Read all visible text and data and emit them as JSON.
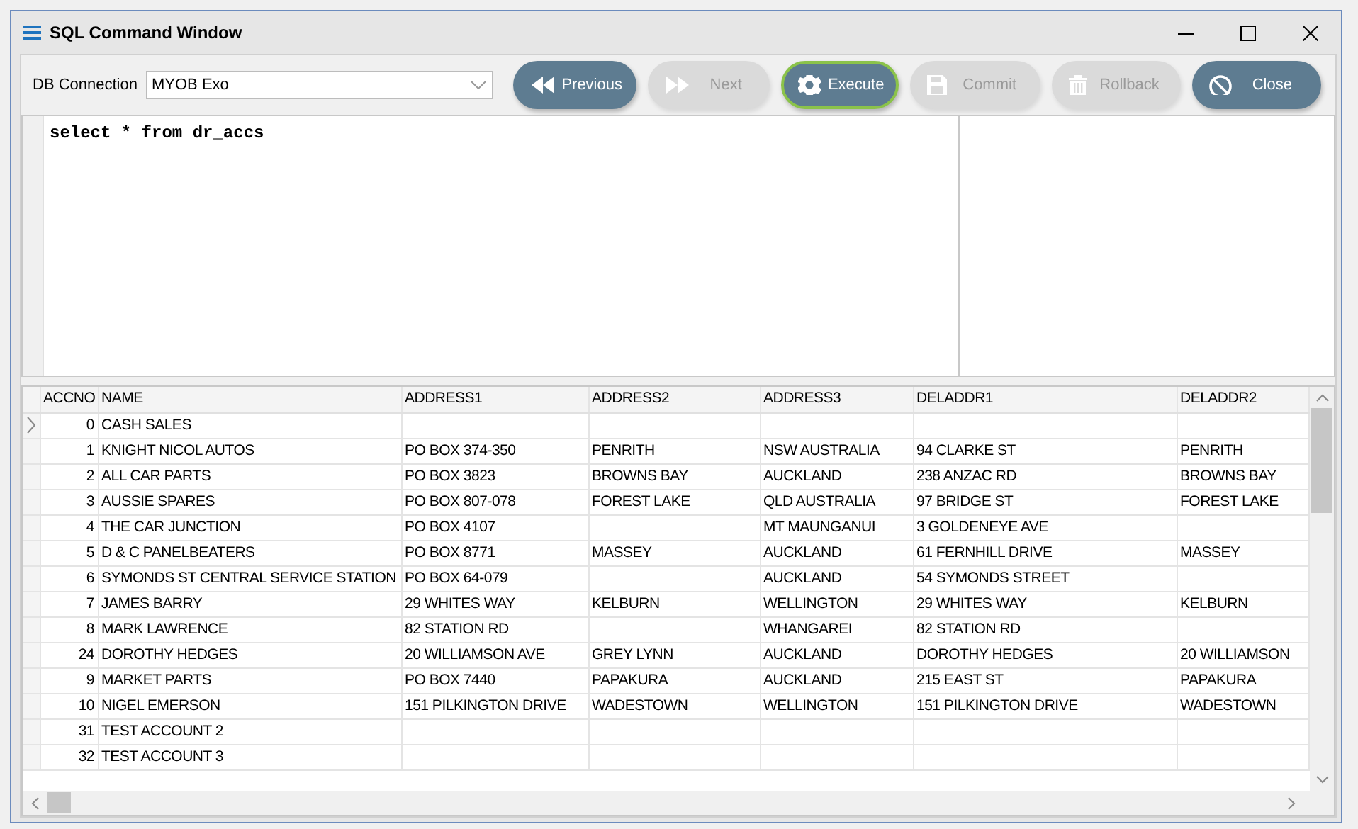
{
  "window": {
    "title": "SQL Command Window"
  },
  "connection": {
    "label": "DB Connection",
    "value": "MYOB Exo"
  },
  "buttons": [
    {
      "label": "Previous",
      "kind": "previous",
      "disabled": false,
      "focused": false
    },
    {
      "label": "Next",
      "kind": "next",
      "disabled": true,
      "focused": false
    },
    {
      "label": "Execute",
      "kind": "execute",
      "disabled": false,
      "focused": true
    },
    {
      "label": "Commit",
      "kind": "commit",
      "disabled": true,
      "focused": false
    },
    {
      "label": "Rollback",
      "kind": "rollback",
      "disabled": true,
      "focused": false
    },
    {
      "label": "Close",
      "kind": "close",
      "disabled": false,
      "focused": false
    }
  ],
  "editor": {
    "text": "select * from dr_accs"
  },
  "table": {
    "columns": [
      "ACCNO",
      "NAME",
      "ADDRESS1",
      "ADDRESS2",
      "ADDRESS3",
      "DELADDR1",
      "DELADDR2"
    ],
    "rows": [
      {
        "current": true,
        "cells": [
          "0",
          "CASH SALES",
          null,
          null,
          null,
          null,
          null
        ]
      },
      {
        "current": false,
        "cells": [
          "1",
          "KNIGHT NICOL AUTOS",
          "PO BOX 374-350",
          "PENRITH",
          "NSW AUSTRALIA",
          "94 CLARKE ST",
          "PENRITH"
        ]
      },
      {
        "current": false,
        "cells": [
          "2",
          "ALL CAR PARTS",
          "PO BOX 3823",
          "BROWNS BAY",
          "AUCKLAND",
          "238 ANZAC RD",
          "BROWNS BAY"
        ]
      },
      {
        "current": false,
        "cells": [
          "3",
          "AUSSIE SPARES",
          "PO BOX 807-078",
          "FOREST LAKE",
          "QLD AUSTRALIA",
          "97 BRIDGE ST",
          "FOREST LAKE"
        ]
      },
      {
        "current": false,
        "cells": [
          "4",
          "THE CAR JUNCTION",
          "PO BOX 4107",
          null,
          "MT MAUNGANUI",
          "3 GOLDENEYE AVE",
          null
        ]
      },
      {
        "current": false,
        "cells": [
          "5",
          "D & C PANELBEATERS",
          "PO BOX 8771",
          "MASSEY",
          "AUCKLAND",
          "61 FERNHILL DRIVE",
          "MASSEY"
        ]
      },
      {
        "current": false,
        "cells": [
          "6",
          "SYMONDS ST CENTRAL SERVICE STATION",
          "PO BOX 64-079",
          null,
          "AUCKLAND",
          "54 SYMONDS STREET",
          null
        ]
      },
      {
        "current": false,
        "cells": [
          "7",
          "JAMES BARRY",
          "29 WHITES WAY",
          "KELBURN",
          "WELLINGTON",
          "29 WHITES WAY",
          "KELBURN"
        ]
      },
      {
        "current": false,
        "cells": [
          "8",
          "MARK LAWRENCE",
          "82 STATION RD",
          null,
          "WHANGAREI",
          "82 STATION RD",
          null
        ]
      },
      {
        "current": false,
        "cells": [
          "24",
          "DOROTHY HEDGES",
          "20 WILLIAMSON AVE",
          "GREY LYNN",
          "AUCKLAND",
          "DOROTHY HEDGES",
          "20 WILLIAMSON"
        ]
      },
      {
        "current": false,
        "cells": [
          "9",
          "MARKET PARTS",
          "PO BOX 7440",
          "PAPAKURA",
          "AUCKLAND",
          "215 EAST ST",
          "PAPAKURA"
        ]
      },
      {
        "current": false,
        "cells": [
          "10",
          "NIGEL EMERSON",
          "151 PILKINGTON DRIVE",
          "WADESTOWN",
          "WELLINGTON",
          "151 PILKINGTON DRIVE",
          "WADESTOWN"
        ]
      },
      {
        "current": false,
        "cells": [
          "31",
          "TEST ACCOUNT 2",
          null,
          null,
          null,
          null,
          null
        ]
      },
      {
        "current": false,
        "cells": [
          "32",
          "TEST ACCOUNT 3",
          null,
          null,
          null,
          null,
          null
        ]
      }
    ]
  }
}
